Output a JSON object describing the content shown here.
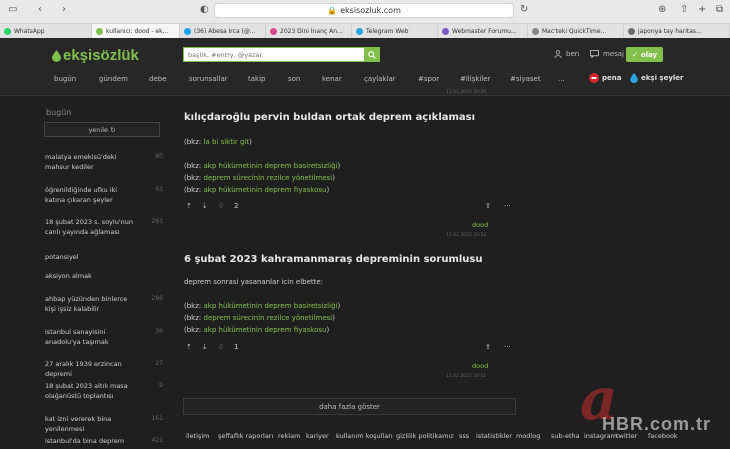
{
  "browser": {
    "url": "eksisozluk.com",
    "tabs": [
      {
        "label": "WhatsApp",
        "color": "#25d366"
      },
      {
        "label": "kullanıcı: dood - ek...",
        "color": "#81c14b",
        "active": true
      },
      {
        "label": "(36) Abesa Irca (@...",
        "color": "#1da1f2"
      },
      {
        "label": "2023 Dini İnanç An...",
        "color": "#d94a8c"
      },
      {
        "label": "Telegram Web",
        "color": "#2aa3e0"
      },
      {
        "label": "Webmaster Forumu...",
        "color": "#7a5cc1"
      },
      {
        "label": "Mac'teki QuickTime...",
        "color": "#888888"
      },
      {
        "label": "japonya tay haritas...",
        "color": "#6d6d6d"
      }
    ]
  },
  "header": {
    "logo": "ekşisözlük",
    "search_placeholder": "başlık, #entry, @yazar",
    "user_label": "ben",
    "message_label": "mesaj",
    "olay_label": "olay"
  },
  "nav": {
    "items": [
      "bugün",
      "gündem",
      "debe",
      "sorunsallar",
      "takip",
      "son",
      "kenar",
      "çaylaklar",
      "#spor",
      "#ilişkiler",
      "#siyaset",
      "..."
    ],
    "pena": "pena",
    "eksi_seyler": "ekşi şeyler"
  },
  "sidebar": {
    "title": "bugün",
    "refresh_label": "yenile ↻",
    "items": [
      {
        "title": "malatya emekisü'deki mahsur kediler",
        "count": "80"
      },
      {
        "title": "öğrenildiğinde ufku iki katına çıkaran şeyler",
        "count": "63"
      },
      {
        "title": "18 şubat 2023 s. soylu'nun canlı yayında ağlaması",
        "count": "263"
      },
      {
        "title": "potansiyel",
        "count": ""
      },
      {
        "title": "aksiyon almak",
        "count": ""
      },
      {
        "title": "ahbap yüzünden binlerce kişi işsiz kalabilir",
        "count": "286"
      },
      {
        "title": "istanbul sanayisini anadolu'ya taşımak",
        "count": "36"
      },
      {
        "title": "27 aralık 1939 erzincan depremi",
        "count": "27"
      },
      {
        "title": "18 şubat 2023 altılı masa olağanüstü toplantısı",
        "count": "9"
      },
      {
        "title": "kat izni vererek bina yenilenmesi",
        "count": "161"
      },
      {
        "title": "istanbul'da bina deprem",
        "count": "421"
      }
    ]
  },
  "entries": [
    {
      "top_date": "11.02.2023 20:56",
      "title": "kılıçdaroğlu pervin buldan ortak deprem açıklaması",
      "lines": [
        {
          "pre": "(bkz: ",
          "link": "la bi siktir git",
          "post": ")"
        },
        {
          "pre": "(bkz: ",
          "link": "akp hükümetinin deprem basiretsizliği",
          "post": ")"
        },
        {
          "pre": "(bkz: ",
          "link": "deprem sürecinin rezilce yönetilmesi",
          "post": ")"
        },
        {
          "pre": "(bkz: ",
          "link": "akp hükümetinin deprem fiyaskosu",
          "post": ")"
        }
      ],
      "favorites": "2",
      "author": "dood",
      "date": "11.02.2023 20:52"
    },
    {
      "title": "6 şubat 2023 kahramanmaraş depreminin sorumlusu",
      "intro": "deprem sonrasi yasananlar icin elbette:",
      "lines": [
        {
          "pre": "(bkz: ",
          "link": "akp hükümetinin deprem basiretsizliği",
          "post": ")"
        },
        {
          "pre": "(bkz: ",
          "link": "deprem sürecinin rezilce yönetilmesi",
          "post": ")"
        },
        {
          "pre": "(bkz: ",
          "link": "akp hükümetinin deprem fiyaskosu",
          "post": ")"
        }
      ],
      "favorites": "1",
      "author": "dood",
      "date": "11.02.2023 20:11"
    }
  ],
  "more_label": "daha fazla göster",
  "footer": [
    "iletişim",
    "şeffaflık raporları",
    "reklam",
    "kariyer",
    "kullanım koşulları",
    "gizlilik politikamız",
    "sss",
    "istatistikler",
    "modlog",
    "sub-etha",
    "instagram",
    "twitter",
    "facebook"
  ],
  "watermark": {
    "letter": "a",
    "text": "HBR.com.tr"
  }
}
